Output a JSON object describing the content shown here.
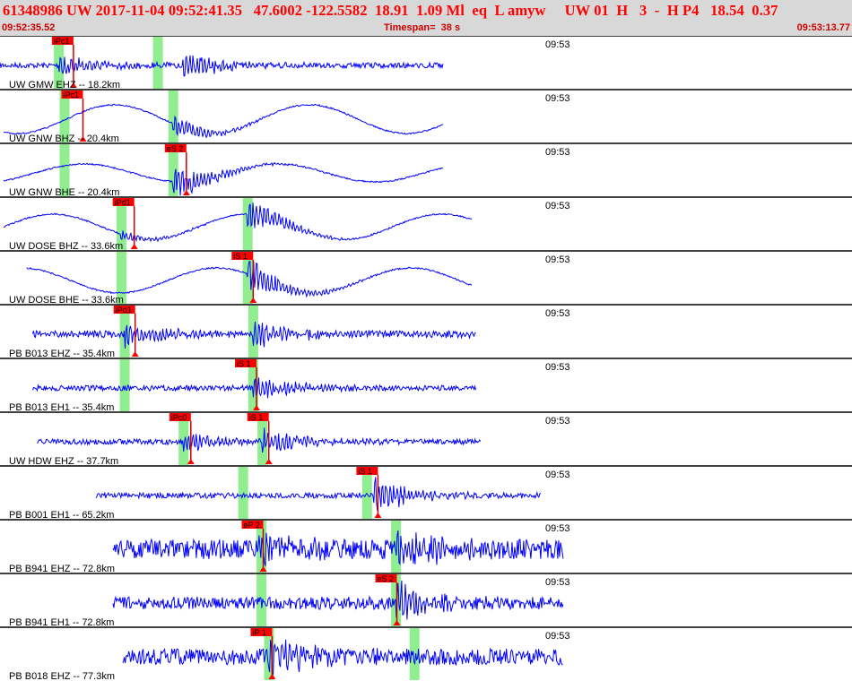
{
  "header": {
    "title": "61348986 UW 2017-11-04 09:52:41.35   47.6002 -122.5582  18.91  1.09 Ml  eq  L amyw     UW 01  H   3  -  H P4   18.54  0.37",
    "start_time": "09:52:35.52",
    "timespan": "Timespan=  38 s",
    "end_time": "09:53:13.77"
  },
  "colors": {
    "trace": "#0000ff",
    "pick_label_bg": "#ff0000",
    "pick_window": "#90ee90",
    "header_bg": "#d8d8d8",
    "title": "#ff0000"
  },
  "channels": [
    {
      "label": "UW GMW EHZ -- 18.2km",
      "time_tick": "09:53",
      "picks": [
        {
          "label": "iPc1",
          "t": 2.33
        }
      ],
      "windows": [
        2.62,
        7.07
      ],
      "extent": [
        0.0,
        19.9
      ],
      "waveform": "noisy",
      "amp": 3,
      "events": [
        {
          "t": 2.62,
          "a": 14
        },
        {
          "t": 8.1,
          "a": 18
        }
      ]
    },
    {
      "label": "UW GNW BHZ -- 20.4km",
      "time_tick": "09:53",
      "picks": [
        {
          "label": "iPc1",
          "t": 2.76
        }
      ],
      "windows": [
        2.88,
        7.76
      ],
      "extent": [
        0.16,
        19.9
      ],
      "waveform": "wavy",
      "amp": 16,
      "events": [
        {
          "t": 7.76,
          "a": 14
        }
      ]
    },
    {
      "label": "UW GNW BHE -- 20.4km",
      "time_tick": "09:53",
      "picks": [
        {
          "label": "eS 2",
          "t": 7.4
        }
      ],
      "windows": [
        2.88,
        7.76
      ],
      "extent": [
        0.16,
        19.9
      ],
      "waveform": "wavy",
      "amp": 10,
      "events": [
        {
          "t": 7.76,
          "a": 22
        }
      ]
    },
    {
      "label": "UW DOSE BHZ -- 33.6km",
      "time_tick": "09:53",
      "picks": [
        {
          "label": "iPd1",
          "t": 5.06
        }
      ],
      "windows": [
        5.43,
        11.1
      ],
      "extent": [
        0.16,
        21.2
      ],
      "waveform": "wavy",
      "amp": 14,
      "events": [
        {
          "t": 5.43,
          "a": 6
        },
        {
          "t": 11.1,
          "a": 20
        }
      ]
    },
    {
      "label": "UW DOSE BHE -- 33.6km",
      "time_tick": "09:53",
      "picks": [
        {
          "label": "iS 1",
          "t": 10.4
        }
      ],
      "windows": [
        5.43,
        11.1
      ],
      "extent": [
        1.2,
        21.2
      ],
      "waveform": "wavy",
      "amp": 14,
      "events": [
        {
          "t": 11.1,
          "a": 24
        }
      ]
    },
    {
      "label": "PB B013 EHZ -- 35.4km",
      "time_tick": "09:53",
      "picks": [
        {
          "label": "iPd1",
          "t": 5.1
        }
      ],
      "windows": [
        5.58,
        11.35
      ],
      "extent": [
        1.47,
        21.4
      ],
      "waveform": "noisy",
      "amp": 4,
      "events": [
        {
          "t": 5.58,
          "a": 14
        },
        {
          "t": 11.35,
          "a": 20
        }
      ]
    },
    {
      "label": "PB B013 EH1 -- 35.4km",
      "time_tick": "09:53",
      "picks": [
        {
          "label": "iS 1",
          "t": 10.55
        }
      ],
      "windows": [
        5.58,
        11.35
      ],
      "extent": [
        1.47,
        21.4
      ],
      "waveform": "noisy",
      "amp": 3,
      "events": [
        {
          "t": 11.35,
          "a": 18
        }
      ]
    },
    {
      "label": "UW HDW EHZ -- 37.7km",
      "time_tick": "09:53",
      "picks": [
        {
          "label": "iPc0",
          "t": 7.6
        },
        {
          "label": "iS 1",
          "t": 11.1
        }
      ],
      "windows": [
        8.22,
        11.76
      ],
      "extent": [
        1.68,
        21.6
      ],
      "waveform": "noisy",
      "amp": 3,
      "events": [
        {
          "t": 8.22,
          "a": 14
        },
        {
          "t": 11.76,
          "a": 18
        }
      ]
    },
    {
      "label": "PB B001 EH1 -- 65.2km",
      "time_tick": "09:53",
      "picks": [
        {
          "label": "iS 1",
          "t": 16.0
        }
      ],
      "windows": [
        10.9,
        16.46
      ],
      "extent": [
        4.3,
        24.3
      ],
      "waveform": "noisy",
      "amp": 3,
      "events": [
        {
          "t": 16.75,
          "a": 22
        }
      ]
    },
    {
      "label": "PB B941 EHZ -- 72.8km",
      "time_tick": "09:53",
      "picks": [
        {
          "label": "eP 2",
          "t": 10.85
        }
      ],
      "windows": [
        11.72,
        17.76
      ],
      "extent": [
        5.07,
        25.3
      ],
      "waveform": "noisy",
      "amp": 11,
      "events": [
        {
          "t": 11.55,
          "a": 16
        },
        {
          "t": 17.76,
          "a": 26
        }
      ]
    },
    {
      "label": "PB B941 EH1 -- 72.8km",
      "time_tick": "09:53",
      "picks": [
        {
          "label": "eS 2",
          "t": 16.85
        }
      ],
      "windows": [
        11.72,
        17.76
      ],
      "extent": [
        5.07,
        25.3
      ],
      "waveform": "noisy",
      "amp": 7,
      "events": [
        {
          "t": 17.76,
          "a": 24
        }
      ]
    },
    {
      "label": "PB B018 EHZ -- 77.3km",
      "time_tick": "09:53",
      "picks": [
        {
          "label": "iP 1",
          "t": 11.25
        }
      ],
      "windows": [
        12.06,
        18.59
      ],
      "extent": [
        5.5,
        25.3
      ],
      "waveform": "noisy",
      "amp": 9,
      "events": [
        {
          "t": 12.06,
          "a": 24
        }
      ]
    }
  ]
}
